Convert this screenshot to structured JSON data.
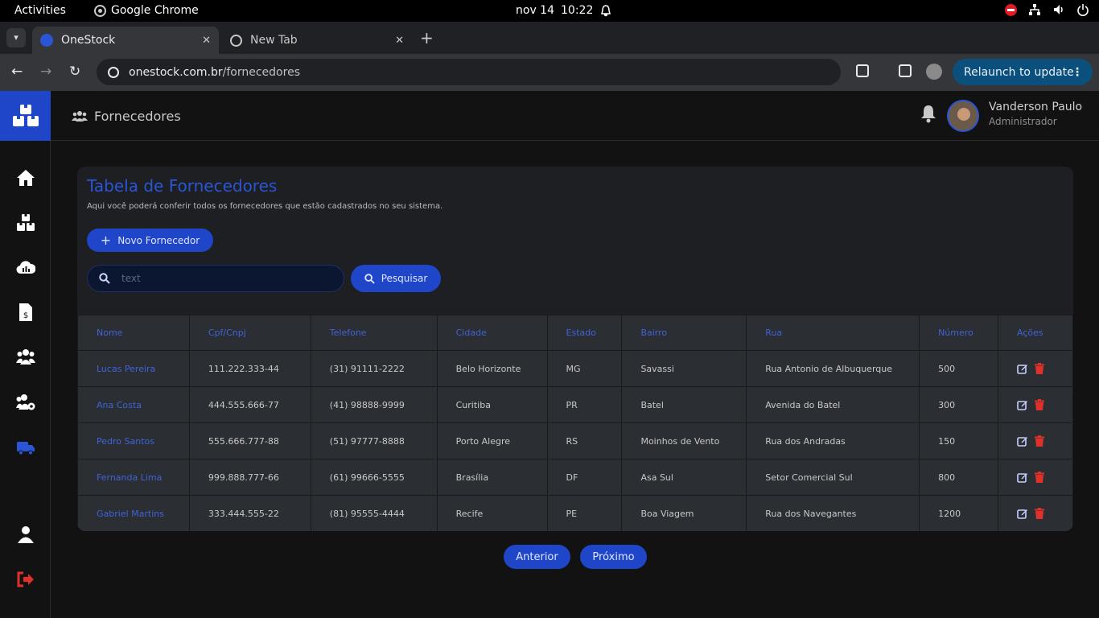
{
  "system": {
    "activities": "Activities",
    "app_name": "Google Chrome",
    "date": "nov 14",
    "time": "10:22"
  },
  "browser": {
    "tabs": [
      {
        "title": "OneStock",
        "active": true
      },
      {
        "title": "New Tab",
        "active": false
      }
    ],
    "url_domain": "onestock.com.br",
    "url_path": "/fornecedores",
    "relaunch_label": "Relaunch to update"
  },
  "header": {
    "page_title": "Fornecedores",
    "user_name": "Vanderson Paulo",
    "user_role": "Administrador"
  },
  "sidebar": {
    "items": [
      "home-icon",
      "boxes-icon",
      "cloud-chart-icon",
      "invoice-icon",
      "users-icon",
      "users-gear-icon",
      "truck-icon",
      "user-icon",
      "logout-icon"
    ],
    "active_color": "#2a56d6",
    "logout_color": "#e0302a"
  },
  "card": {
    "title": "Tabela de Fornecedores",
    "subtitle": "Aqui você poderá conferir todos os fornecedores que estão cadastrados no seu sistema.",
    "new_button": "Novo Fornecedor",
    "search_placeholder": "text",
    "search_button": "Pesquisar"
  },
  "table": {
    "headers": [
      "Nome",
      "Cpf/Cnpj",
      "Telefone",
      "Cidade",
      "Estado",
      "Bairro",
      "Rua",
      "Número",
      "Ações"
    ],
    "rows": [
      [
        "Lucas Pereira",
        "111.222.333-44",
        "(31) 91111-2222",
        "Belo Horizonte",
        "MG",
        "Savassi",
        "Rua Antonio de Albuquerque",
        "500"
      ],
      [
        "Ana Costa",
        "444.555.666-77",
        "(41) 98888-9999",
        "Curitiba",
        "PR",
        "Batel",
        "Avenida do Batel",
        "300"
      ],
      [
        "Pedro Santos",
        "555.666.777-88",
        "(51) 97777-8888",
        "Porto Alegre",
        "RS",
        "Moinhos de Vento",
        "Rua dos Andradas",
        "150"
      ],
      [
        "Fernanda Lima",
        "999.888.777-66",
        "(61) 99666-5555",
        "Brasília",
        "DF",
        "Asa Sul",
        "Setor Comercial Sul",
        "800"
      ],
      [
        "Gabriel Martins",
        "333.444.555-22",
        "(81) 95555-4444",
        "Recife",
        "PE",
        "Boa Viagem",
        "Rua dos Navegantes",
        "1200"
      ]
    ]
  },
  "pagination": {
    "prev": "Anterior",
    "next": "Próximo"
  },
  "colors": {
    "accent": "#1f45c9",
    "delete": "#e0302a"
  }
}
